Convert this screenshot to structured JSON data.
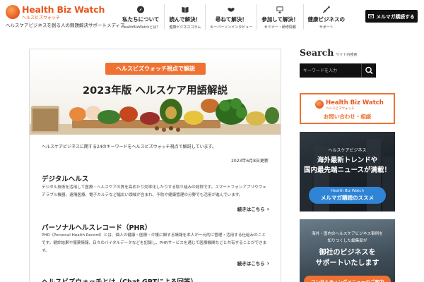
{
  "header": {
    "logo_text": "Health Biz Watch",
    "logo_sub": "ヘルスビズウォッチ",
    "tagline": "ヘルスケアビジネスを創る人の問題解決サポートメディア",
    "nav": [
      {
        "icon": "compass-icon",
        "label": "私たちについて",
        "sub": "HealthBizWatchとは？"
      },
      {
        "icon": "book-icon",
        "label": "読んで解決！",
        "sub": "健康ビジネスコラム"
      },
      {
        "icon": "handshake-icon",
        "label": "尋ねて解決！",
        "sub": "キーパーソンインタビュー"
      },
      {
        "icon": "presentation-icon",
        "label": "参加して解決！",
        "sub": "セミナー・研修情報"
      },
      {
        "icon": "syringe-icon",
        "label": "健康ビジネスの",
        "sub": "サポート"
      }
    ],
    "mail_button": "メルマガ購読する"
  },
  "article": {
    "hero_badge": "ヘルスビズウォッチ視点で解説",
    "hero_title": "2023年版 ヘルスケア用語解説",
    "intro": "ヘルスケアビジネスに関する24のキーワードをヘルスビズウォッチ視点で解説しています。",
    "date": "2023年6月8日更新",
    "sections": [
      {
        "title": "デジタルヘルス",
        "body": "デジタル技術を活用して医療・ヘルスケアの質を高めたり効率化したりする取り組みの総称です。スマートフォンアプリやウェアラブル機器、遠隔医療、電子カルテなど幅広い領域が含まれ、予防や健康管理の分野でも活用が進んでいます。",
        "more": "続きはこちら"
      },
      {
        "title": "パーソナルヘルスレコード（PHR）",
        "body": "PHR（Personal Health Record）とは、個人の健康・医療・介護に関する情報を本人が一元的に管理・活用する仕組みのことです。健診結果や服薬情報、日々のバイタルデータなどを記録し、PHRサービスを通じて医療機関などと共有することができます。",
        "more": "続きはこちら"
      },
      {
        "title": "ヘルスビズウォッチとは（Chat GPTによる回答）",
        "body": "",
        "more": ""
      }
    ]
  },
  "sidebar": {
    "search_title": "Search",
    "search_title_small": "サイト内検索",
    "search_placeholder": "キーワードを入力",
    "contact_logo": "Health Biz Watch",
    "contact_logo_sub": "ヘルスビズウォッチ",
    "contact_label": "お問い合わせ・相談",
    "promo1": {
      "label": "ヘルスケアビジネス",
      "headline_1": "海外最新トレンドや",
      "headline_2": "国内最先端ニュースが満載！",
      "btn_sub": "Health Biz Watch",
      "btn_main": "メルマガ購読のススメ"
    },
    "promo2": {
      "small_1": "海外・国内のヘルスケアビジネス事例を",
      "small_2": "知りつくした編集部が",
      "big_1": "御社のビジネスを",
      "big_2": "サポートいたします",
      "btn": "コンサルティングメニューのご案内"
    }
  },
  "colors": {
    "accent": "#ef7233",
    "logo": "#e8561e",
    "button_blue": "#2f84d6",
    "dark": "#111111"
  }
}
